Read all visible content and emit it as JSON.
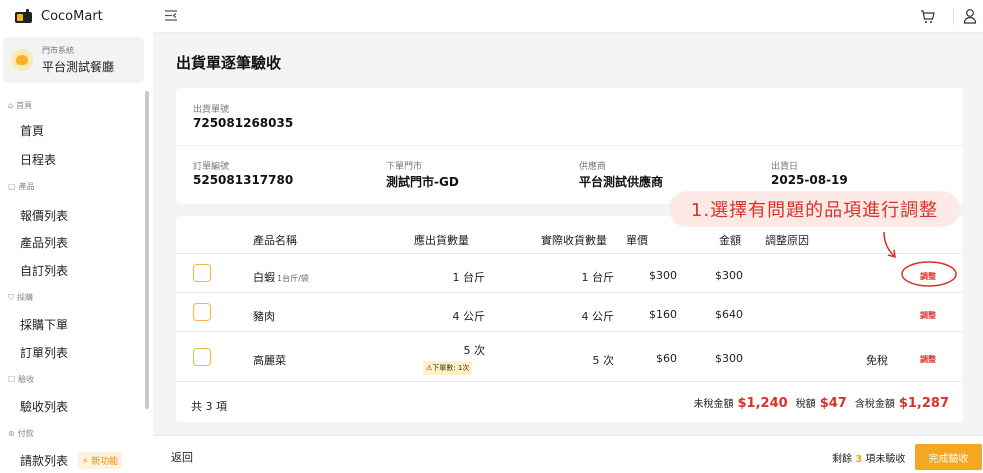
{
  "app": {
    "name": "CocoMart"
  },
  "store": {
    "system_label": "門市系統",
    "name": "平台測試餐廳"
  },
  "sidebar": {
    "sections": [
      {
        "label": "首頁",
        "icon": "home-icon"
      },
      {
        "label": "產品",
        "icon": "box-icon"
      },
      {
        "label": "採購",
        "icon": "cart-icon"
      },
      {
        "label": "驗收",
        "icon": "check-icon"
      },
      {
        "label": "付款",
        "icon": "dollar-icon"
      }
    ],
    "items": [
      {
        "label": "首頁"
      },
      {
        "label": "日程表"
      },
      {
        "label": "報價列表"
      },
      {
        "label": "產品列表"
      },
      {
        "label": "自訂列表"
      },
      {
        "label": "採購下單"
      },
      {
        "label": "訂單列表"
      },
      {
        "label": "驗收列表"
      },
      {
        "label": "請款列表",
        "badge": "新功能"
      }
    ]
  },
  "page": {
    "title": "出貨單逐筆驗收"
  },
  "shipment": {
    "number_label": "出貨單號",
    "number": "725081268035",
    "order_no_label": "訂單編號",
    "order_no": "525081317780",
    "store_label": "下單門市",
    "store": "測試門市-GD",
    "supplier_label": "供應商",
    "supplier": "平台測試供應商",
    "ship_date_label": "出貨日",
    "ship_date": "2025-08-19"
  },
  "table": {
    "headers": {
      "name": "產品名稱",
      "expected": "應出貨數量",
      "received": "實際收貨數量",
      "price": "單價",
      "amount": "金額",
      "reason": "調整原因"
    },
    "rows": [
      {
        "name": "白蝦",
        "unit_note": "1台斤/袋",
        "expected": "1 台斤",
        "received": "1 台斤",
        "price": "$300",
        "amount": "$300",
        "tax": "",
        "action": "調整"
      },
      {
        "name": "豬肉",
        "unit_note": "",
        "expected": "4 公斤",
        "received": "4 公斤",
        "price": "$160",
        "amount": "$640",
        "tax": "",
        "action": "調整"
      },
      {
        "name": "高麗菜",
        "unit_note": "",
        "expected": "5 次",
        "warning": "⚠下單數: 1次",
        "received": "5 次",
        "price": "$60",
        "amount": "$300",
        "tax": "免稅",
        "action": "調整"
      }
    ],
    "total_count": "共 3 項",
    "pretax_label": "未稅金額",
    "pretax": "$1,240",
    "tax_label": "稅額",
    "tax": "$47",
    "total_label": "含稅金額",
    "total": "$1,287"
  },
  "callout": {
    "text": "1.選擇有問題的品項進行調整",
    "color": "#d9322b"
  },
  "footer": {
    "back_label": "返回",
    "remain_prefix": "剩餘",
    "remain_count": "3",
    "remain_suffix": "項未驗收",
    "complete_label": "完成驗收"
  },
  "colors": {
    "accent": "#f5a623",
    "danger": "#d9322b"
  }
}
